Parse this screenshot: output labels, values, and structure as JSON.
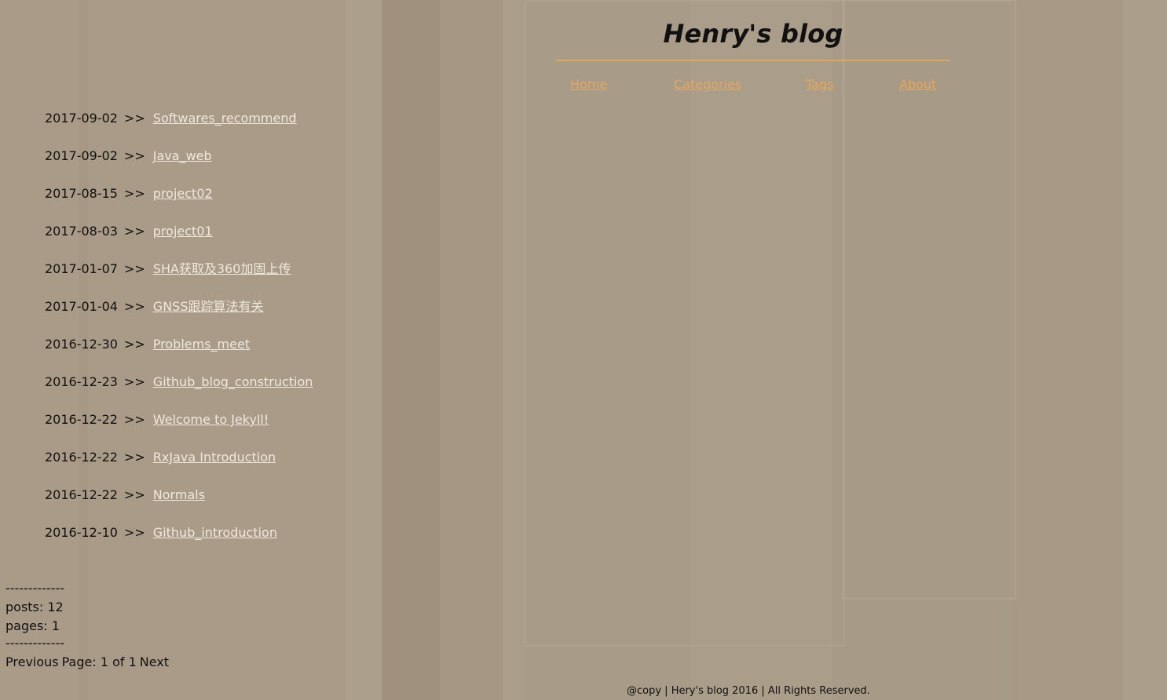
{
  "header": {
    "title": "Henry's blog"
  },
  "nav": {
    "items": [
      {
        "label": "Home"
      },
      {
        "label": "Categories"
      },
      {
        "label": "Tags"
      },
      {
        "label": "About"
      }
    ]
  },
  "posts": [
    {
      "date": "2017-09-02",
      "sep": ">>",
      "title": "Softwares_recommend"
    },
    {
      "date": "2017-09-02",
      "sep": ">>",
      "title": "Java_web"
    },
    {
      "date": "2017-08-15",
      "sep": ">>",
      "title": "project02"
    },
    {
      "date": "2017-08-03",
      "sep": ">>",
      "title": "project01"
    },
    {
      "date": "2017-01-07",
      "sep": ">>",
      "title": "SHA获取及360加固上传"
    },
    {
      "date": "2017-01-04",
      "sep": ">>",
      "title": "GNSS跟踪算法有关"
    },
    {
      "date": "2016-12-30",
      "sep": ">>",
      "title": "Problems_meet"
    },
    {
      "date": "2016-12-23",
      "sep": ">>",
      "title": "Github_blog_construction"
    },
    {
      "date": "2016-12-22",
      "sep": ">>",
      "title": "Welcome to Jekyll!"
    },
    {
      "date": "2016-12-22",
      "sep": ">>",
      "title": "RxJava Introduction"
    },
    {
      "date": "2016-12-22",
      "sep": ">>",
      "title": "Normals"
    },
    {
      "date": "2016-12-10",
      "sep": ">>",
      "title": "Github_introduction"
    }
  ],
  "stats": {
    "divider": "-------------",
    "posts_line": "posts: 12",
    "pages_line": "pages: 1",
    "previous_label": "Previous",
    "page_status": "Page: 1 of 1",
    "next_label": "Next"
  },
  "footer": {
    "text": "@copy | Hery's blog 2016 | All Rights Reserved."
  },
  "colors": {
    "accent": "#e4a75f",
    "link": "#f0e8dc",
    "text": "#111111",
    "background": "#a89a86"
  }
}
